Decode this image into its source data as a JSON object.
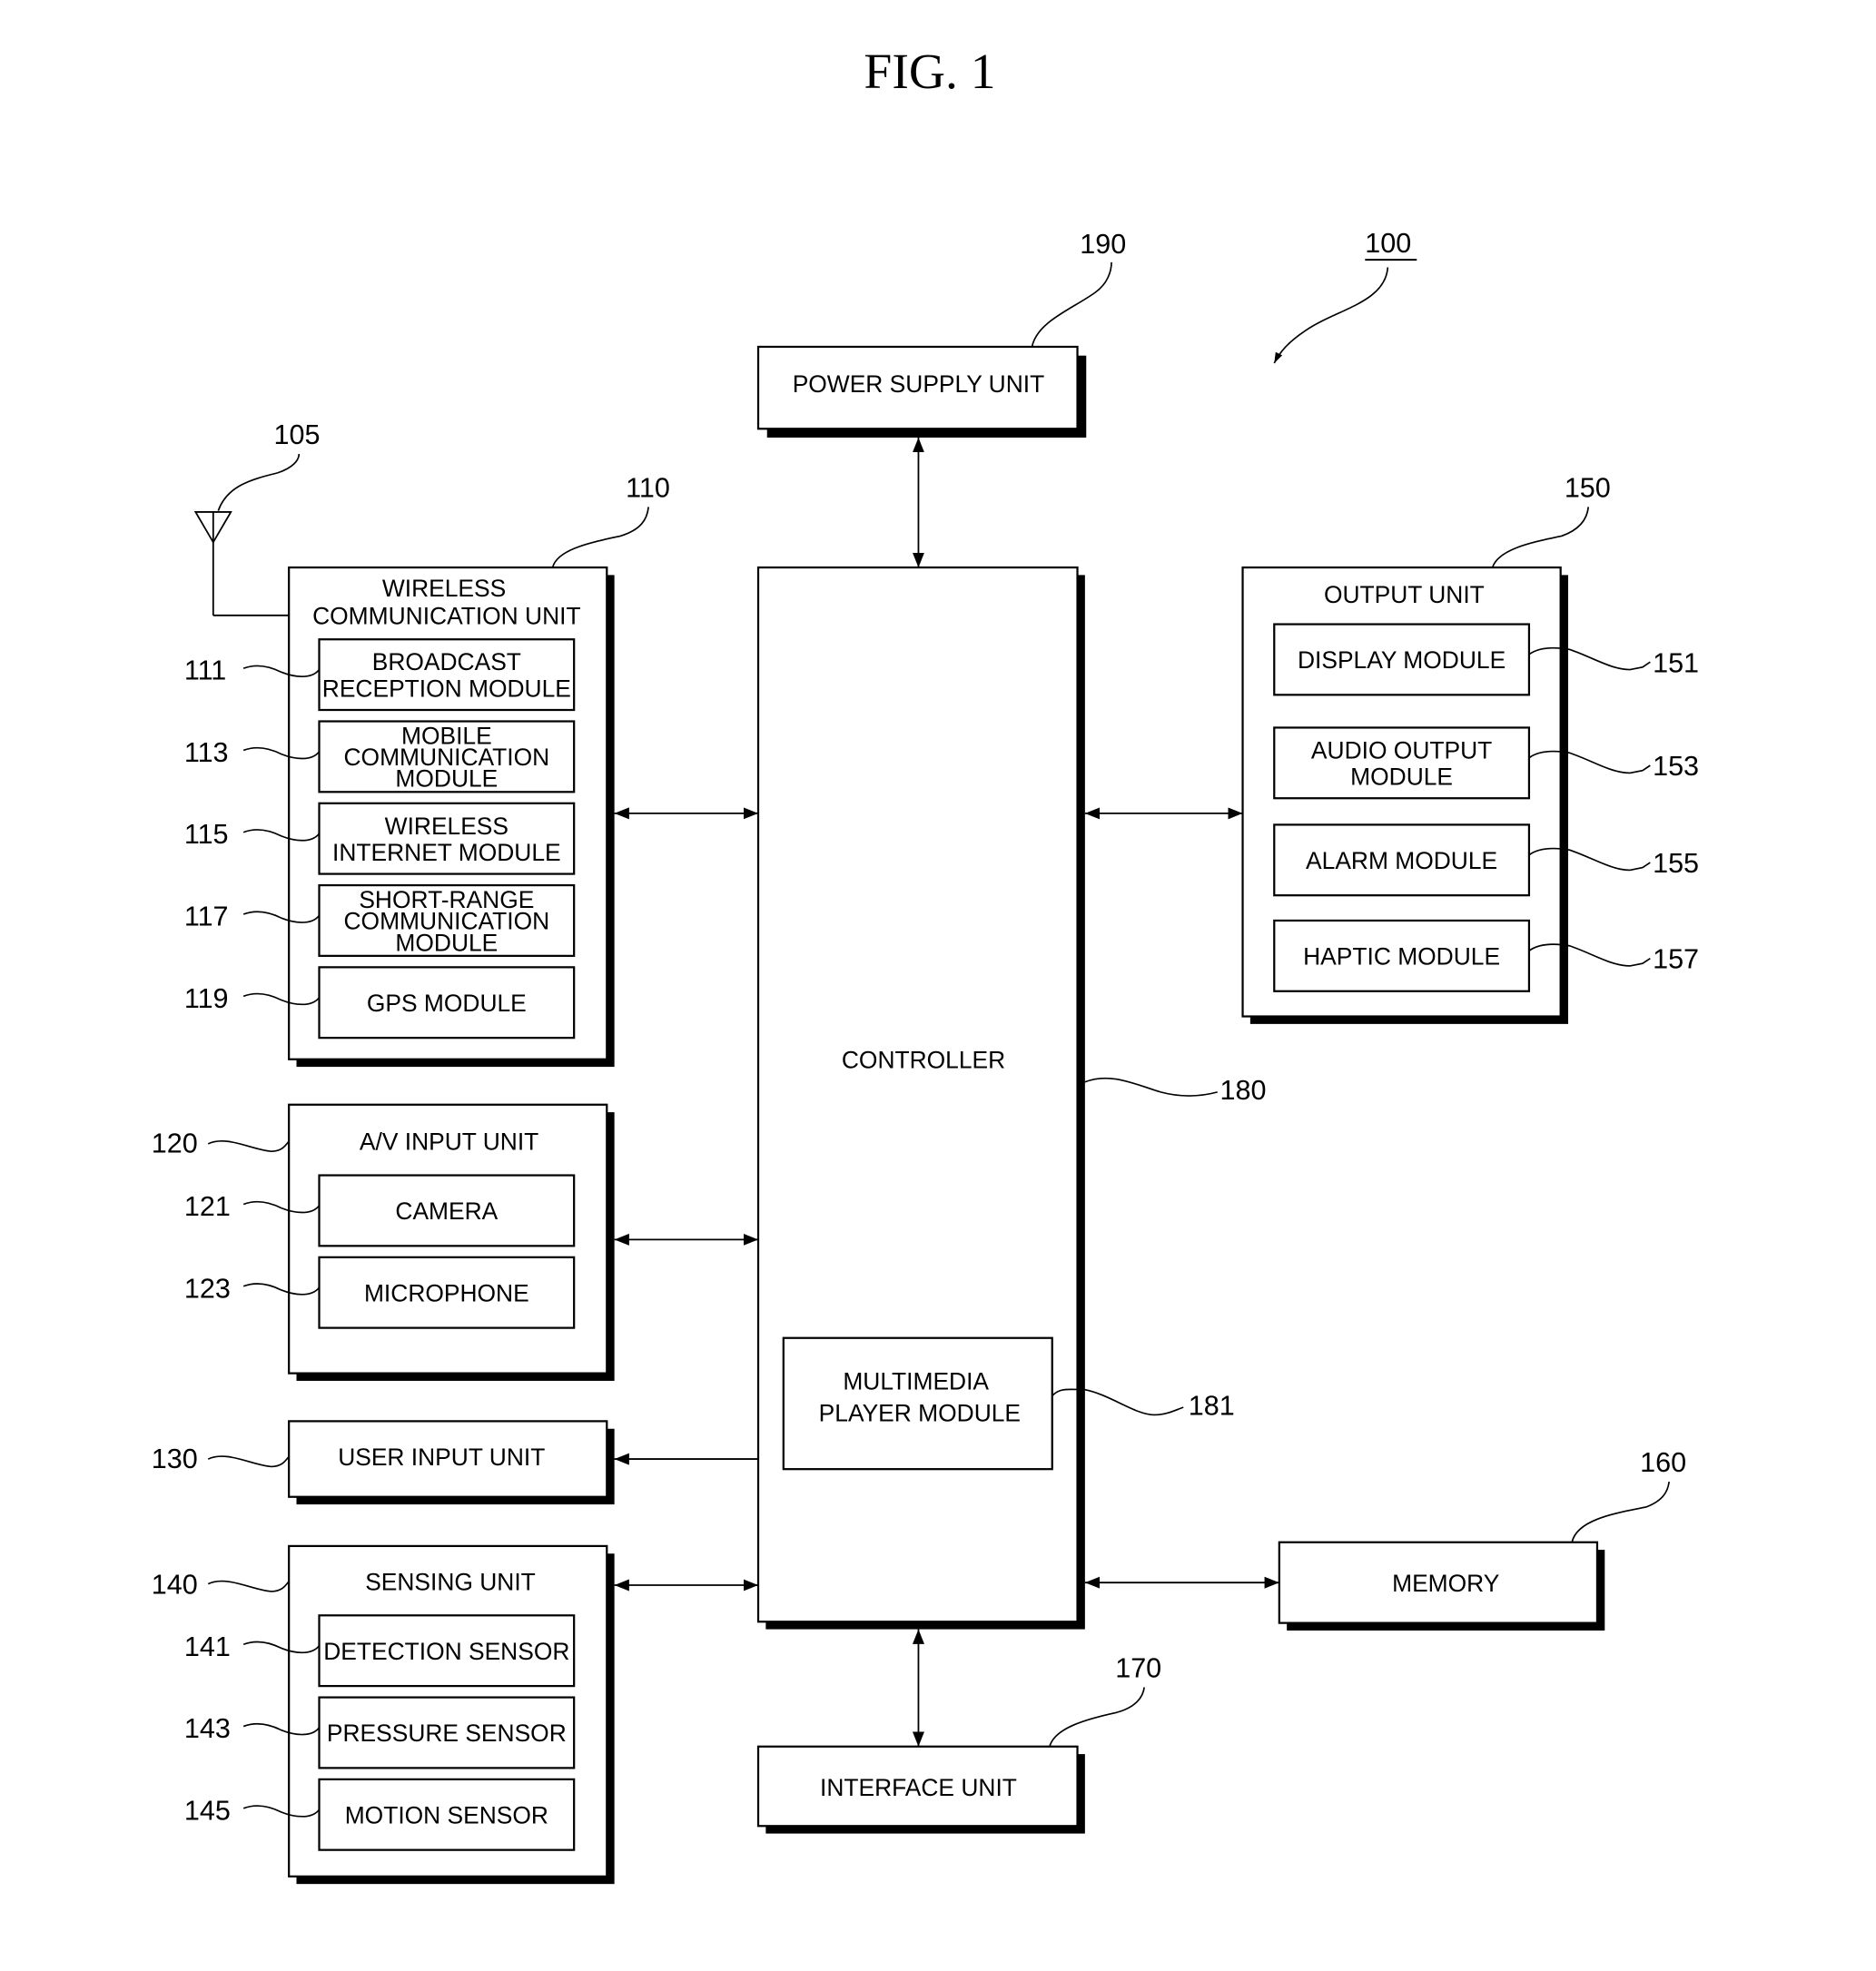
{
  "figure": {
    "title": "FIG. 1",
    "device_ref": "100"
  },
  "colors": {
    "line": "#000000",
    "background": "#ffffff"
  },
  "antenna": {
    "ref": "105"
  },
  "blocks": {
    "power_supply": {
      "ref": "190",
      "lines": [
        "POWER SUPPLY UNIT"
      ]
    },
    "wireless": {
      "ref": "110",
      "lines": [
        "WIRELESS",
        "COMMUNICATION UNIT"
      ],
      "modules": [
        {
          "ref": "111",
          "lines": [
            "BROADCAST",
            "RECEPTION MODULE"
          ]
        },
        {
          "ref": "113",
          "lines": [
            "MOBILE",
            "COMMUNICATION",
            "MODULE"
          ]
        },
        {
          "ref": "115",
          "lines": [
            "WIRELESS",
            "INTERNET MODULE"
          ]
        },
        {
          "ref": "117",
          "lines": [
            "SHORT-RANGE",
            "COMMUNICATION",
            "MODULE"
          ]
        },
        {
          "ref": "119",
          "lines": [
            "GPS MODULE"
          ]
        }
      ]
    },
    "av_input": {
      "ref": "120",
      "lines": [
        "A/V INPUT UNIT"
      ],
      "modules": [
        {
          "ref": "121",
          "lines": [
            "CAMERA"
          ]
        },
        {
          "ref": "123",
          "lines": [
            "MICROPHONE"
          ]
        }
      ]
    },
    "user_input": {
      "ref": "130",
      "lines": [
        "USER INPUT UNIT"
      ]
    },
    "sensing": {
      "ref": "140",
      "lines": [
        "SENSING UNIT"
      ],
      "modules": [
        {
          "ref": "141",
          "lines": [
            "DETECTION SENSOR"
          ]
        },
        {
          "ref": "143",
          "lines": [
            "PRESSURE SENSOR"
          ]
        },
        {
          "ref": "145",
          "lines": [
            "MOTION SENSOR"
          ]
        }
      ]
    },
    "output": {
      "ref": "150",
      "lines": [
        "OUTPUT UNIT"
      ],
      "modules": [
        {
          "ref": "151",
          "lines": [
            "DISPLAY MODULE"
          ]
        },
        {
          "ref": "153",
          "lines": [
            "AUDIO OUTPUT",
            "MODULE"
          ]
        },
        {
          "ref": "155",
          "lines": [
            "ALARM MODULE"
          ]
        },
        {
          "ref": "157",
          "lines": [
            "HAPTIC MODULE"
          ]
        }
      ]
    },
    "controller": {
      "ref": "180",
      "lines": [
        "CONTROLLER"
      ],
      "modules": [
        {
          "ref": "181",
          "lines": [
            "MULTIMEDIA",
            "PLAYER MODULE"
          ]
        }
      ]
    },
    "memory": {
      "ref": "160",
      "lines": [
        "MEMORY"
      ]
    },
    "interface": {
      "ref": "170",
      "lines": [
        "INTERFACE UNIT"
      ]
    }
  }
}
